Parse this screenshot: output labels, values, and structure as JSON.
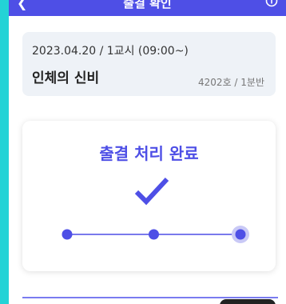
{
  "appbar": {
    "title": "출결 확인",
    "back_icon": "back-arrow-icon",
    "info_icon": "info-icon"
  },
  "class_info": {
    "meta": "2023.04.20 / 1교시 (09:00~)",
    "name": "인체의 신비",
    "room": "4202호 / 1분반"
  },
  "attendance": {
    "status_title": "출결 처리 완료",
    "check_icon": "check-icon",
    "steps_total": 3,
    "current_step": 3
  },
  "colors": {
    "accent": "#4e4fe6",
    "step_dot": "#4e4fe6",
    "step_halo": "#c9c9f6",
    "card_bg": "#eef2f7",
    "side_bg": "#23d3d6"
  }
}
